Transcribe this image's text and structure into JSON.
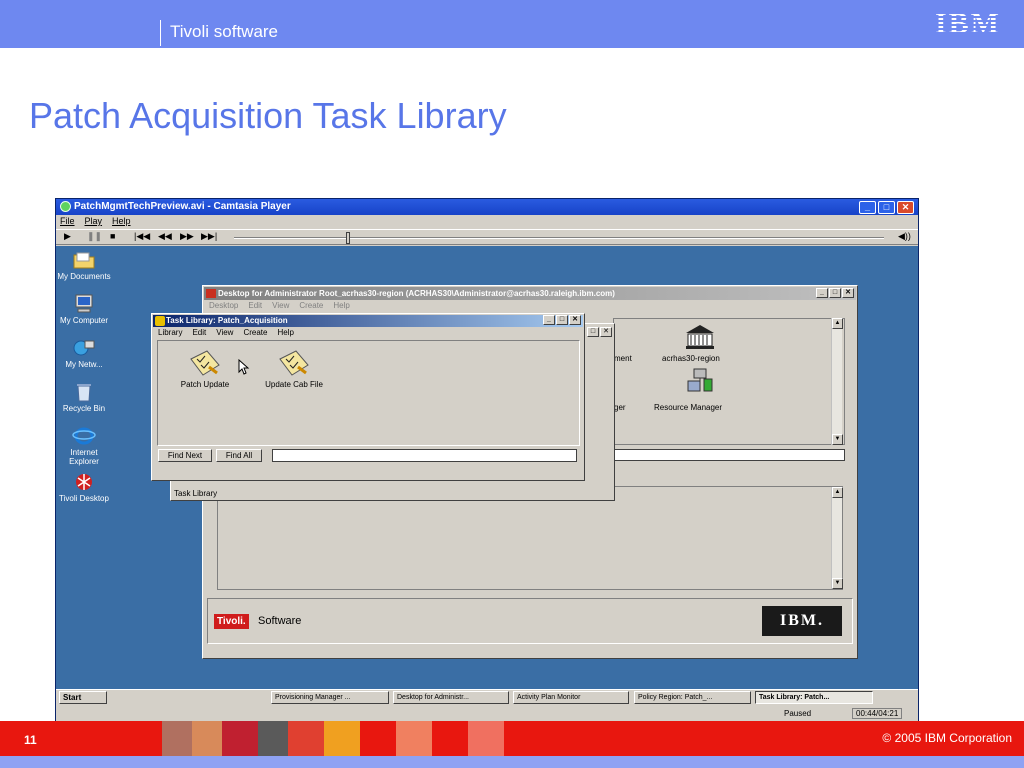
{
  "header": {
    "brand": "Tivoli software",
    "logo_text": "IBM"
  },
  "slide": {
    "title": "Patch Acquisition Task Library",
    "page_number": "11",
    "copyright": "© 2005 IBM Corporation"
  },
  "colors": {
    "header_band": "#6e88f0",
    "title": "#5876e8",
    "footer": "#e8170f",
    "desktop": "#3a6ea5"
  },
  "camtasia": {
    "title": "PatchMgmtTechPreview.avi - Camtasia Player",
    "menu": [
      "File",
      "Play",
      "Help"
    ],
    "controls": [
      "play-icon",
      "pause-icon",
      "stop-icon",
      "first-icon",
      "rewind-icon",
      "fast-forward-icon",
      "last-icon",
      "volume-icon"
    ],
    "status": "Paused",
    "time": "00:44/04:21"
  },
  "desktop_icons": [
    {
      "label": "My Documents",
      "icon": "folder-icon"
    },
    {
      "label": "My Computer",
      "icon": "computer-icon"
    },
    {
      "label": "My Netw...",
      "icon": "network-icon"
    },
    {
      "label": "Recycle Bin",
      "icon": "recycle-bin-icon"
    },
    {
      "label": "Internet Explorer",
      "icon": "ie-icon"
    },
    {
      "label": "Tivoli Desktop",
      "icon": "tivoli-icon"
    }
  ],
  "tivoli_desktop": {
    "title": "Desktop for Administrator Root_acrhas30-region (ACRHAS30\\Administrator@acrhas30.raleigh.ibm.com)",
    "menu": [
      "Desktop",
      "Edit",
      "View",
      "Create",
      "Help"
    ],
    "icons": [
      "ment",
      "acrhas30-region",
      "ger",
      "Resource Manager"
    ],
    "brand_logo": "Tivoli.",
    "brand_text": "Software",
    "ibm_logo": "IBM."
  },
  "task_library_back": {
    "status": "Task Library"
  },
  "task_library": {
    "title": "Task Library: Patch_Acquisition",
    "menu": [
      "Library",
      "Edit",
      "View",
      "Create",
      "Help"
    ],
    "tasks": [
      "Patch Update",
      "Update Cab File"
    ],
    "find_next": "Find Next",
    "find_all": "Find All",
    "find_value": ""
  },
  "taskbar": {
    "start": "Start",
    "items": [
      "Provisioning Manager ...",
      "Desktop for Administr...",
      "Activity Plan Monitor",
      "Policy Region: Patch_...",
      "Task Library: Patch..."
    ]
  }
}
